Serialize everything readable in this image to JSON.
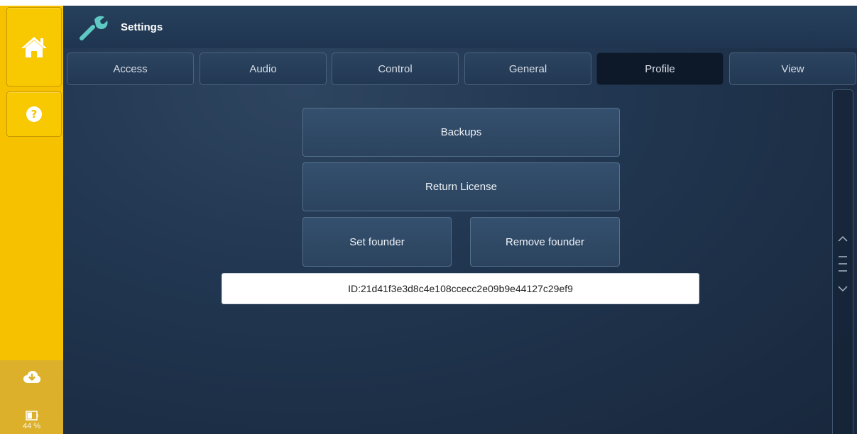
{
  "header": {
    "title": "Settings",
    "icon": "wrench-icon"
  },
  "tabs": [
    {
      "label": "Access",
      "active": false
    },
    {
      "label": "Audio",
      "active": false
    },
    {
      "label": "Control",
      "active": false
    },
    {
      "label": "General",
      "active": false
    },
    {
      "label": "Profile",
      "active": true
    },
    {
      "label": "View",
      "active": false
    }
  ],
  "profile": {
    "backups_label": "Backups",
    "return_license_label": "Return License",
    "set_founder_label": "Set founder",
    "remove_founder_label": "Remove founder",
    "id_value": "ID:21d41f3e3d8c4e108ccecc2e09b9e44127c29ef9"
  },
  "sidebar": {
    "home_icon": "home-icon",
    "help_icon": "help-icon",
    "cloud_icon": "cloud-download-icon",
    "battery_icon": "battery-icon",
    "battery_percent": "44 %"
  },
  "colors": {
    "sidebar_yellow": "#f6c200",
    "panel_dark": "#213650",
    "active_tab": "#0d1828",
    "wrench_teal": "#5fc9c4"
  }
}
